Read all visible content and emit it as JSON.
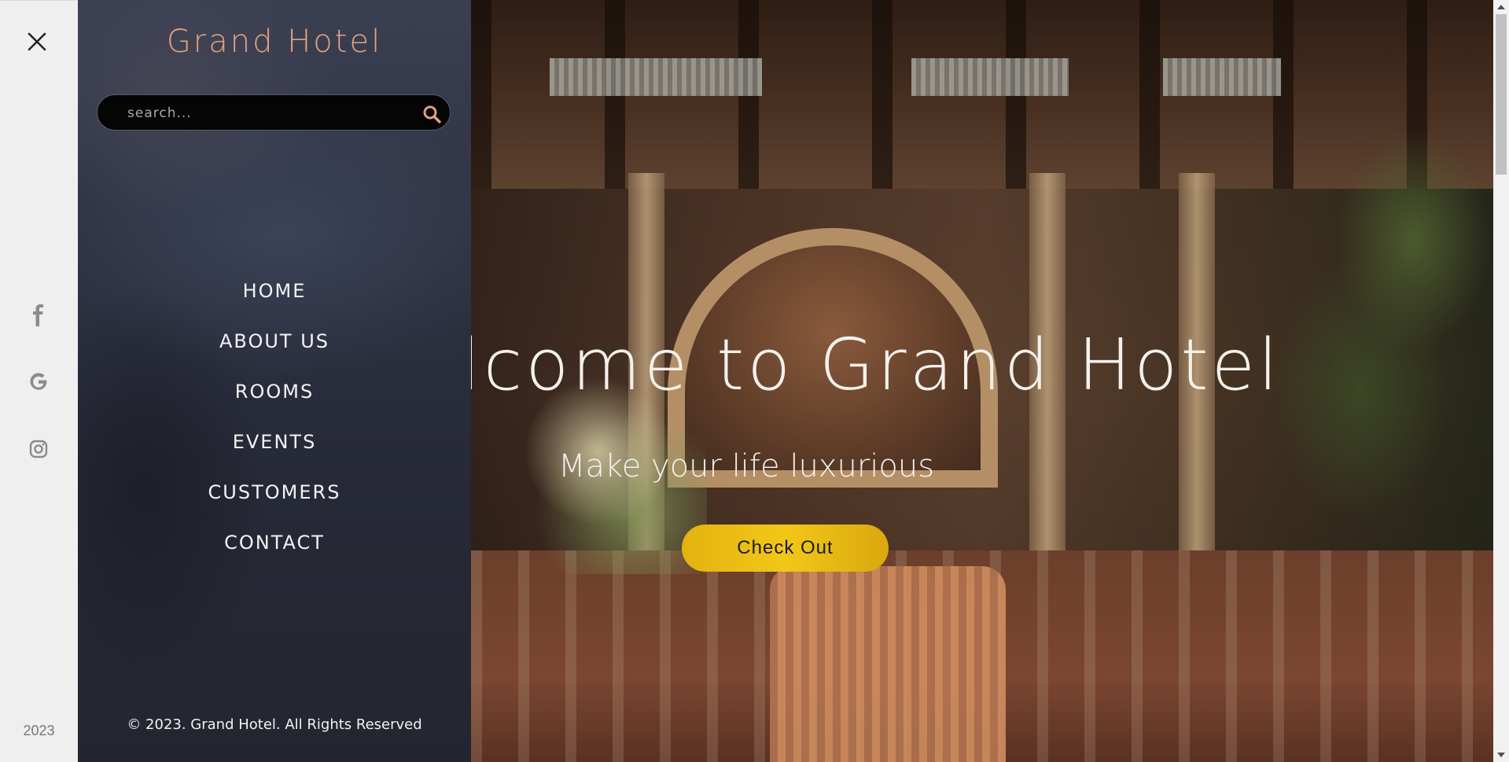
{
  "rail": {
    "close_icon": "close-icon",
    "social_icons": [
      "facebook-icon",
      "google-icon",
      "instagram-icon"
    ],
    "year": "2023"
  },
  "menu": {
    "brand": "Grand Hotel",
    "search": {
      "placeholder": "search...",
      "value": "",
      "icon": "search-icon"
    },
    "items": [
      {
        "label": "HOME"
      },
      {
        "label": "ABOUT US"
      },
      {
        "label": "ROOMS"
      },
      {
        "label": "EVENTS"
      },
      {
        "label": "CUSTOMERS"
      },
      {
        "label": "CONTACT"
      }
    ],
    "copyright": "© 2023. Grand Hotel. All Rights Reserved"
  },
  "hero": {
    "title": "Welcome to Grand Hotel",
    "subtitle": "Make your life luxurious",
    "cta_label": "Check Out"
  },
  "colors": {
    "brand_accent": "#e3a27e",
    "cta_yellow": "#f2c718",
    "panel_dark": "#2a2d3a",
    "rail_bg": "#efefef"
  }
}
